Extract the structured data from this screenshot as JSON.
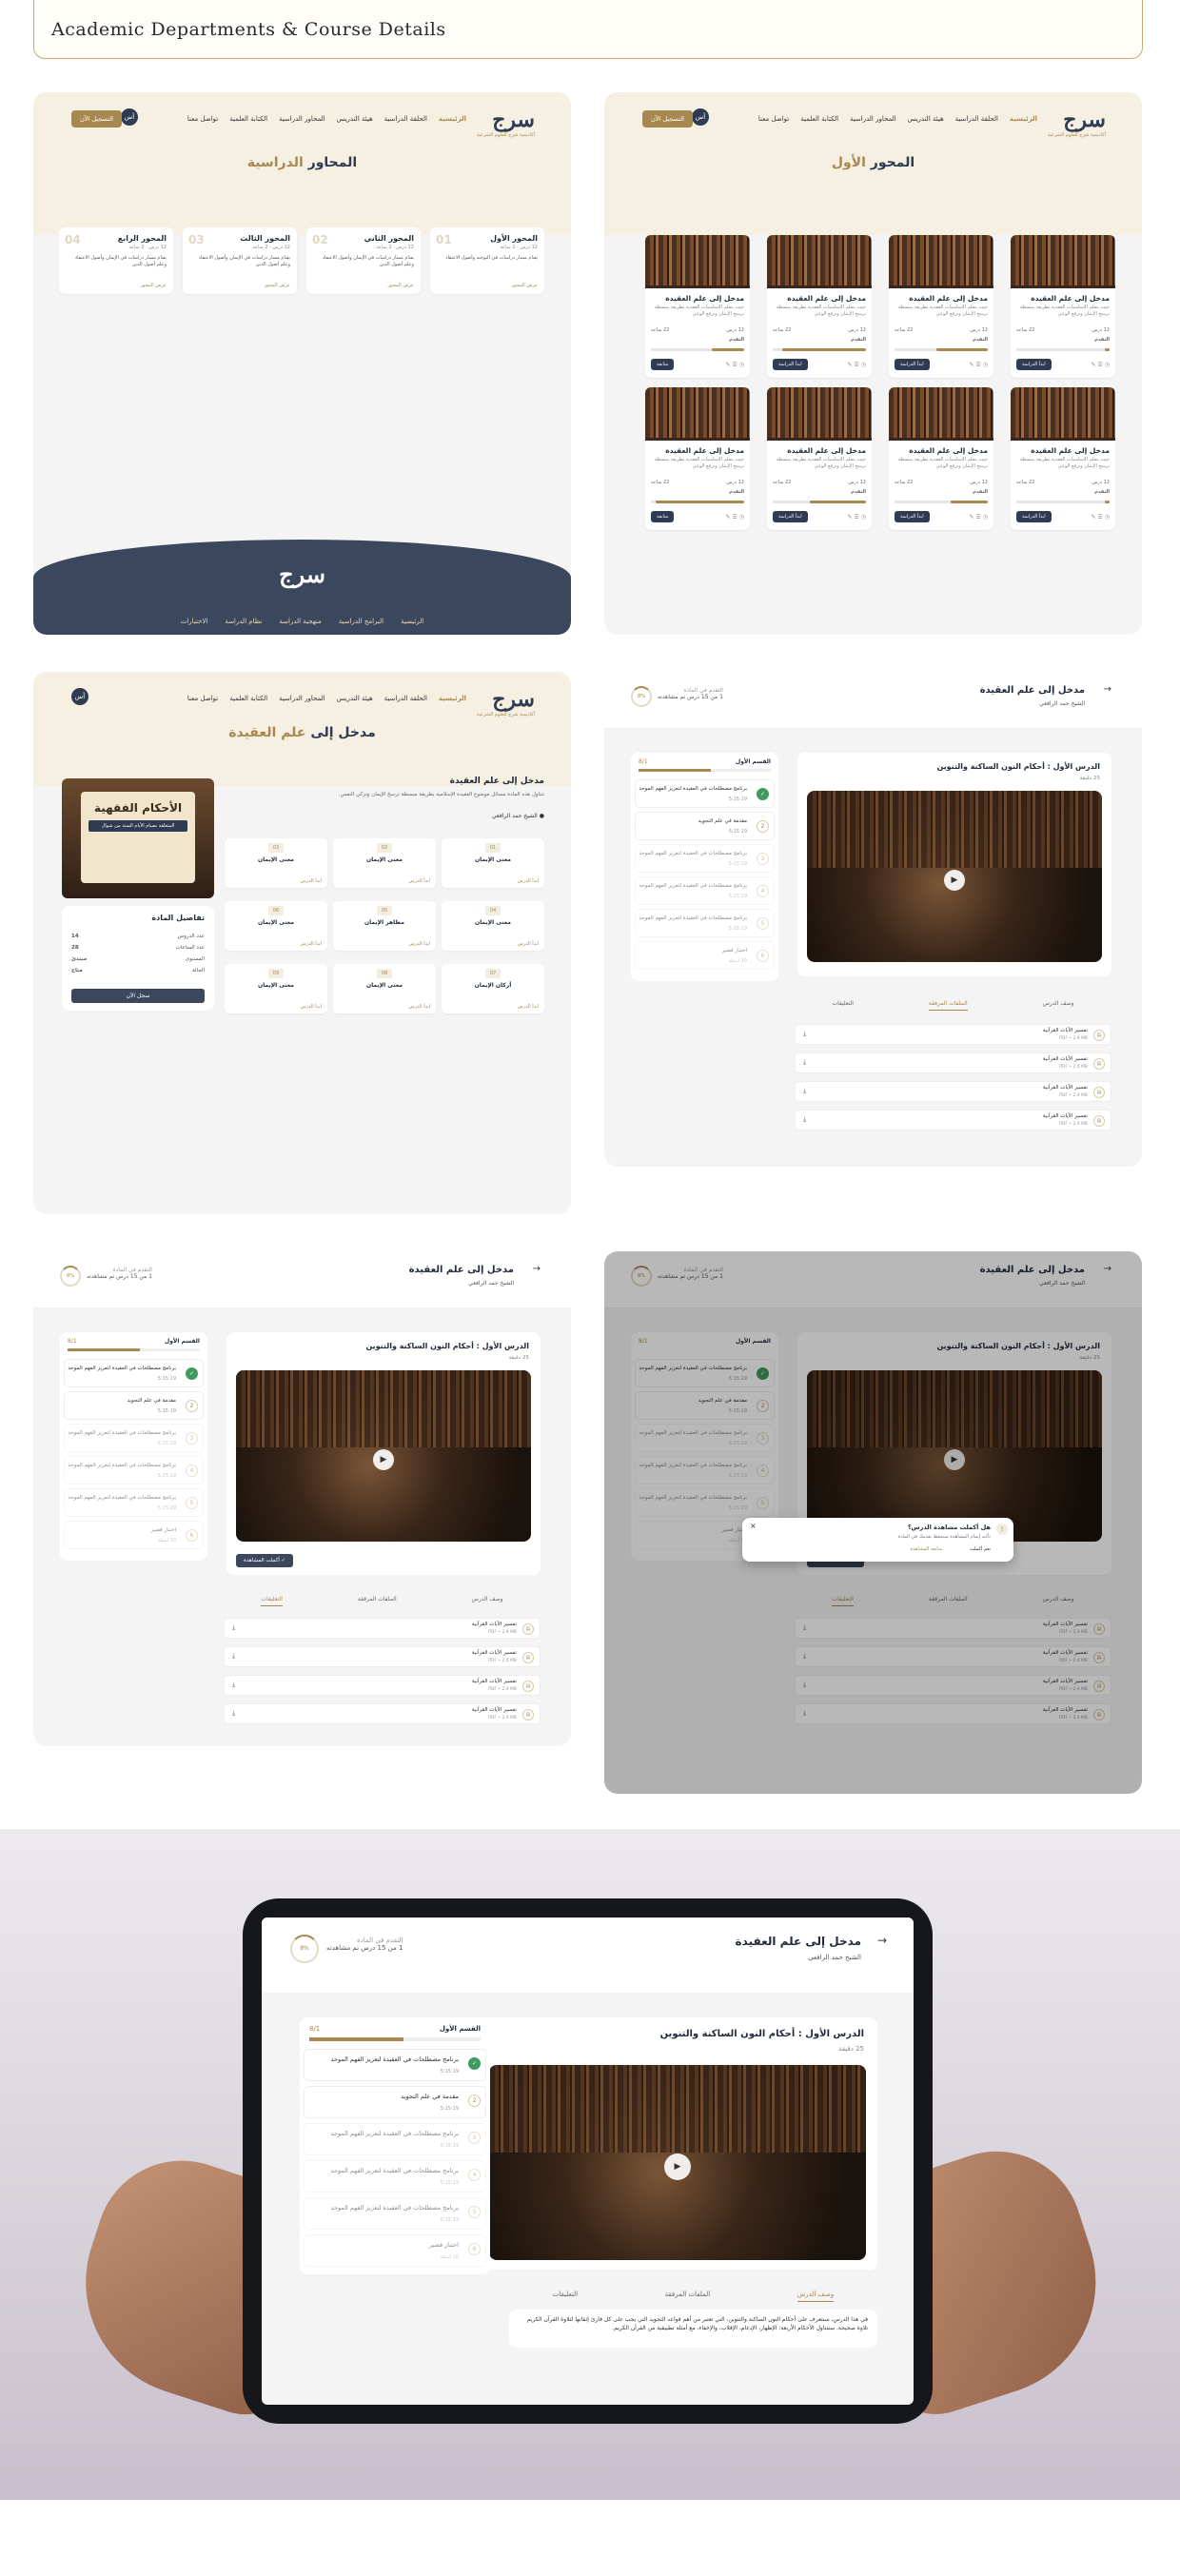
{
  "title": "Academic Departments & Course Details",
  "nav": {
    "logo": "سرج",
    "logo_sub": "أكاديمية شرح للعلوم الشرعية",
    "links": [
      "الرئيسية",
      "الحلقة الدراسية",
      "هيئة التدريس",
      "المحاور الدراسية",
      "الكتابة العلمية",
      "تواصل معنا"
    ],
    "cta": "التسجيل الآن",
    "avatar": "أس"
  },
  "panel1": {
    "title_prefix": "المحور",
    "title_accent": "الأول",
    "book_title": "مدخل إلى علم العقيدة",
    "book_desc": "حيث نتعلم الأساسيات العقدية بطريقة مبسطة ترسخ الإيمان وترفع الوعي",
    "book_meta1": "12 درس",
    "book_meta2": "22 ساعة",
    "book_label": "التقدم",
    "book_btn_a": "ابدأ الدراسة",
    "book_btn_b": "متابعة",
    "progress": [
      0.05,
      0.55,
      0.9,
      0.35,
      0.05,
      0.4,
      0.6,
      0.95
    ]
  },
  "panel2": {
    "title_prefix": "المحاور",
    "title_accent": "الدراسية",
    "axes": [
      {
        "n": "01",
        "title": "المحور الأول",
        "sub": "12 درس · 2 ساعة",
        "desc": "يقدّم مسار دراسات في التوحيد وأصول الاعتقاد",
        "link": "عرض المحور"
      },
      {
        "n": "02",
        "title": "المحور الثاني",
        "sub": "12 درس · 2 ساعة",
        "desc": "يقدّم مسار دراسات في الإيمان وأصول الاعتقاد وعلم أصول الدين",
        "link": "عرض المحور"
      },
      {
        "n": "03",
        "title": "المحور الثالث",
        "sub": "12 درس · 2 ساعة",
        "desc": "يقدّم مسار دراسات في الإيمان وأصول الاعتقاد وعلم أصول الدين",
        "link": "عرض المحور"
      },
      {
        "n": "04",
        "title": "المحور الرابع",
        "sub": "12 درس · 2 ساعة",
        "desc": "يقدّم مسار دراسات في الإيمان وأصول الاعتقاد وعلم أصول الدين",
        "link": "عرض المحور"
      }
    ],
    "footer_links": [
      "الرئيسية",
      "البرامج الدراسية",
      "منهجية الدراسة",
      "نظام الدراسة",
      "الاختبارات"
    ]
  },
  "panel3": {
    "title_prefix": "مدخل إلى",
    "title_accent": "علم العقيدة",
    "course_heading": "مدخل إلى علم العقيدة",
    "course_desc": "تتناول هذه المادة مسائل موضوع العقيدة الإسلامية بطريقة مبسطة ترسخ الإيمان وتزكي النفس.",
    "sheikh": "الشيخ حمد الرافعي",
    "book_cover_title": "الأحكام الفقهية",
    "book_cover_sub": "المتعلقة بصيام الأيام الستة من شوال",
    "details_title": "تفاصيل المادة",
    "details": [
      {
        "k": "عدد الدروس",
        "v": "14"
      },
      {
        "k": "عدد الساعات",
        "v": "28"
      },
      {
        "k": "المستوى",
        "v": "مبتدئ"
      },
      {
        "k": "الحالة",
        "v": "متاح"
      }
    ],
    "enroll_btn": "سجل الآن",
    "lessons": [
      {
        "n": "01",
        "t": "معنى الإيمان",
        "l": "ابدأ الدرس"
      },
      {
        "n": "02",
        "t": "معنى الإيمان",
        "l": "ابدأ الدرس"
      },
      {
        "n": "03",
        "t": "معنى الإيمان",
        "l": "ابدأ الدرس"
      },
      {
        "n": "04",
        "t": "معنى الإيمان",
        "l": "ابدأ الدرس"
      },
      {
        "n": "05",
        "t": "مظاهر الإيمان",
        "l": "ابدأ الدرس"
      },
      {
        "n": "06",
        "t": "معنى الإيمان",
        "l": "ابدأ الدرس"
      },
      {
        "n": "07",
        "t": "أركان الإيمان",
        "l": "ابدأ الدرس"
      },
      {
        "n": "08",
        "t": "معنى الإيمان",
        "l": "ابدأ الدرس"
      },
      {
        "n": "09",
        "t": "معنى الإيمان",
        "l": "ابدأ الدرس"
      }
    ]
  },
  "player": {
    "course": "مدخل إلى علم العقيدة",
    "sheikh": "الشيخ حمد الرافعي",
    "progress_label": "التقدم في المادة",
    "progress_text": "1 من 15 درس تم مشاهدته",
    "progress_pct": "8%",
    "lesson_title": "الدرس الأول : أحكام النون الساكنة والتنوين",
    "lesson_duration": "25 دقيقة",
    "section_label": "القسم الأول",
    "section_count": "8/1",
    "list": [
      {
        "t": "برنامج مصطلحات في العقيدة لتعزيز الفهم الموحد",
        "tm": "5:15:19"
      },
      {
        "t": "مقدمة في علم التجويد",
        "tm": "5:15:19"
      },
      {
        "t": "برنامج مصطلحات في العقيدة لتعزيز الفهم الموحد",
        "tm": "5:15:19"
      },
      {
        "t": "برنامج مصطلحات في العقيدة لتعزيز الفهم الموحد",
        "tm": "5:15:19"
      },
      {
        "t": "برنامج مصطلحات في العقيدة لتعزيز الفهم الموحد",
        "tm": "5:15:19"
      },
      {
        "t": "اختبار قصير",
        "tm": "10 أسئلة"
      }
    ],
    "tabs": [
      "وصف الدرس",
      "الملفات المرفقة",
      "التعليقات"
    ],
    "attachment": "تفسير الآيات القرآنية",
    "attachment_size": "PDF • 2.4 MB",
    "complete_btn": "أكملت المشاهدة",
    "modal_title": "هل أكملت مشاهدة الدرس؟",
    "modal_text": "تأكيد إتمام المشاهدة سيحفظ تقدمك في المادة",
    "modal_yes": "نعم أكملت",
    "modal_no": "متابعة المشاهدة",
    "desc_text": "في هذا الدرس، سنتعرف على أحكام النون الساكنة والتنوين، التي تعتبر من أهم قواعد التجويد التي يجب على كل قارئ إتقانها لتلاوة القرآن الكريم تلاوة صحيحة. سنتناول الأحكام الأربعة: الإظهار، الإدغام، الإقلاب، والإخفاء، مع أمثلة تطبيقية من القرآن الكريم."
  }
}
